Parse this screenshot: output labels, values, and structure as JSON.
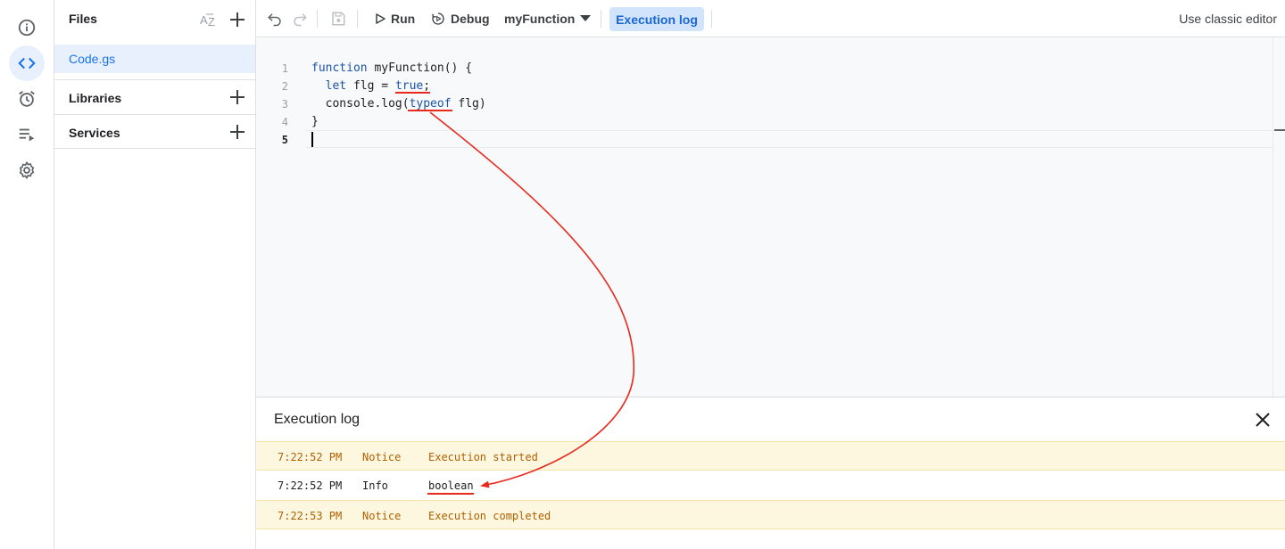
{
  "toolbar": {
    "run_label": "Run",
    "debug_label": "Debug",
    "function_select": "myFunction",
    "execution_log_label": "Execution log",
    "classic_editor_label": "Use classic editor"
  },
  "files_panel": {
    "title": "Files",
    "files": [
      {
        "name": "Code.gs"
      }
    ],
    "sections": [
      {
        "label": "Libraries"
      },
      {
        "label": "Services"
      }
    ]
  },
  "editor": {
    "lines": [
      {
        "number": "1",
        "tokens": [
          {
            "text": "function",
            "kw": true
          },
          {
            "text": " myFunction() {"
          }
        ]
      },
      {
        "number": "2",
        "tokens": [
          {
            "text": "  "
          },
          {
            "text": "let",
            "kw": true
          },
          {
            "text": " flg = "
          },
          {
            "text": "true",
            "kw": true
          },
          {
            "text": ";"
          }
        ]
      },
      {
        "number": "3",
        "tokens": [
          {
            "text": "  console.log("
          },
          {
            "text": "typeof",
            "kw": true
          },
          {
            "text": " flg)"
          }
        ]
      },
      {
        "number": "4",
        "tokens": [
          {
            "text": "}"
          }
        ]
      },
      {
        "number": "5",
        "tokens": []
      }
    ],
    "current_line": "5"
  },
  "execution_log": {
    "title": "Execution log",
    "rows": [
      {
        "time": "7:22:52 PM",
        "level": "Notice",
        "message": "Execution started"
      },
      {
        "time": "7:22:52 PM",
        "level": "Info",
        "message": "boolean"
      },
      {
        "time": "7:22:53 PM",
        "level": "Notice",
        "message": "Execution completed"
      }
    ]
  },
  "colors": {
    "accent": "#1a73e8",
    "annotation": "#e8291c",
    "notice_bg": "#fef7e0",
    "notice_text": "#b06000",
    "keyword": "#1a53a8"
  },
  "icons": {
    "rail": [
      "info-icon",
      "code-icon",
      "alarm-clock-icon",
      "executions-icon",
      "gear-icon"
    ],
    "toolbar": [
      "undo-icon",
      "redo-icon",
      "save-icon",
      "play-icon",
      "debug-icon",
      "chevron-down-icon"
    ]
  }
}
